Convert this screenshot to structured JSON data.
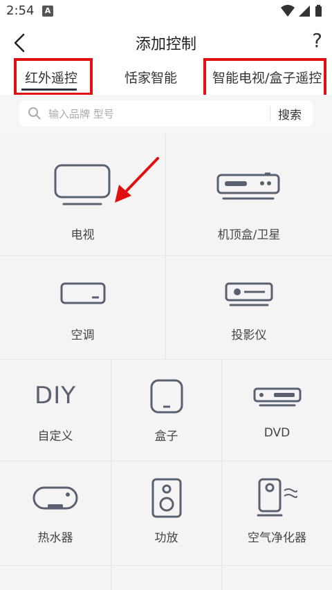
{
  "status": {
    "time": "2:54",
    "notif": "A"
  },
  "header": {
    "title": "添加控制",
    "help": "?"
  },
  "tabs": [
    "红外遥控",
    "恬家智能",
    "智能电视/盒子遥控"
  ],
  "search": {
    "placeholder": "输入品牌 型号",
    "button": "搜索"
  },
  "devices": {
    "tv": "电视",
    "stb": "机顶盒/卫星",
    "ac": "空调",
    "projector": "投影仪",
    "diy": "自定义",
    "diy_icon_text": "DIY",
    "box": "盒子",
    "dvd": "DVD",
    "heater": "热水器",
    "amp": "功放",
    "purifier": "空气净化器"
  },
  "colors": {
    "highlight": "#e01010",
    "icon": "#5a6070"
  }
}
